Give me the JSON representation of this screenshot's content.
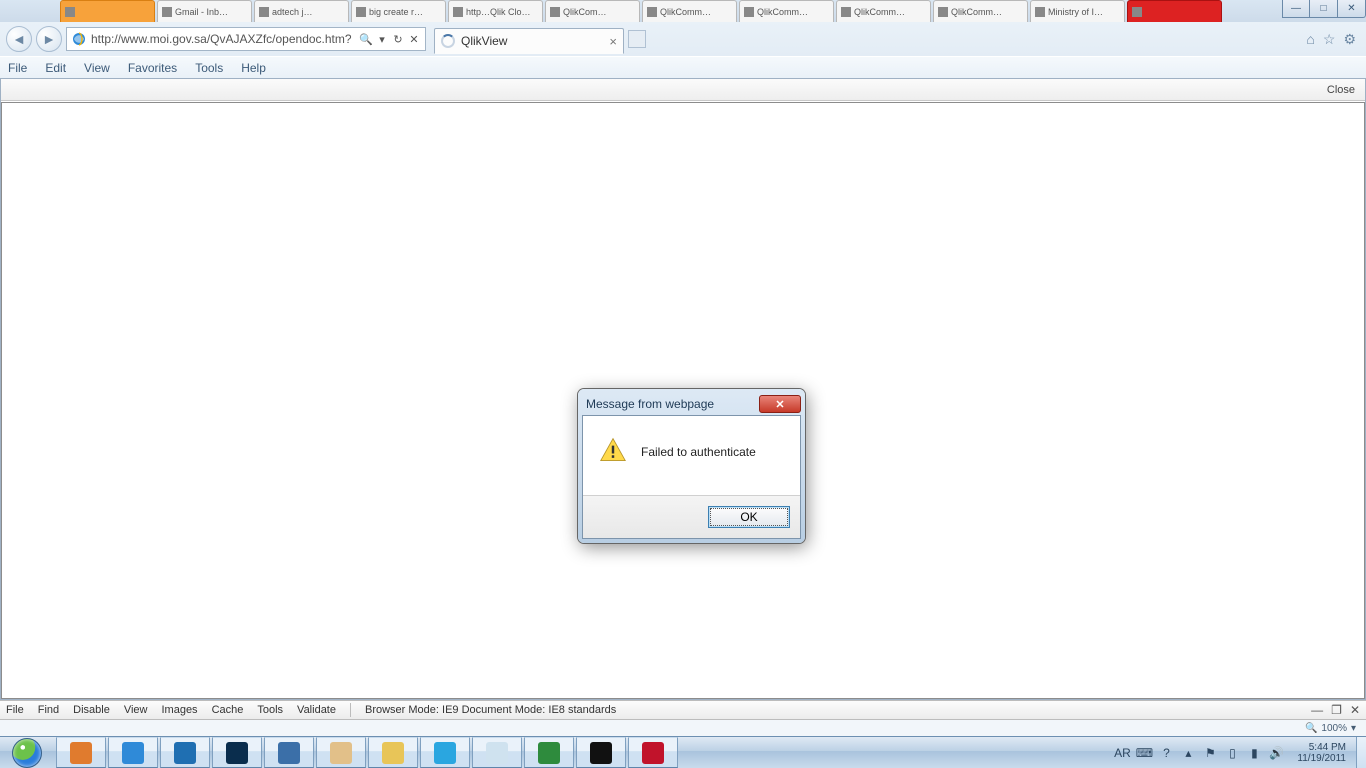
{
  "desktop_tabs": [
    {
      "label": "",
      "cls": "orange"
    },
    {
      "label": "Gmail - Inb…"
    },
    {
      "label": "adtech j…"
    },
    {
      "label": "big create r…"
    },
    {
      "label": "http…Qlik Clo…"
    },
    {
      "label": "QlikCom…"
    },
    {
      "label": "QlikComm…"
    },
    {
      "label": "QlikComm…"
    },
    {
      "label": "QlikComm…"
    },
    {
      "label": "QlikComm…"
    },
    {
      "label": "Ministry of I…"
    },
    {
      "label": "",
      "cls": "red"
    }
  ],
  "window_controls": {
    "min": "—",
    "max": "□",
    "close": "✕"
  },
  "browser": {
    "back": "◄",
    "forward": "►",
    "url": "http://www.moi.gov.sa/QvAJAXZfc/opendoc.htm?",
    "url_bold_part": "moi.gov.sa",
    "search_glyph": "🔍",
    "dropdown_glyph": "▾",
    "refresh_glyph": "↻",
    "stop_glyph": "✕",
    "tab_title": "QlikView",
    "right_icons": {
      "home": "⌂",
      "star": "☆",
      "gear": "⚙"
    }
  },
  "menubar": [
    "File",
    "Edit",
    "View",
    "Favorites",
    "Tools",
    "Help"
  ],
  "page": {
    "close_label": "Close"
  },
  "dialog": {
    "title": "Message from webpage",
    "message": "Failed to authenticate",
    "ok": "OK",
    "close_glyph": "✕"
  },
  "devtools": {
    "items": [
      "File",
      "Find",
      "Disable",
      "View",
      "Images",
      "Cache",
      "Tools",
      "Validate"
    ],
    "mode": "Browser Mode:  IE9   Document Mode:  IE8 standards",
    "right": {
      "min": "—",
      "pop": "❐",
      "close": "✕"
    }
  },
  "status": {
    "zoom": "100%",
    "zoom_glyph": "🔍",
    "dd": "▾"
  },
  "taskbar": {
    "apps": [
      {
        "name": "firefox",
        "color": "#e07b2e"
      },
      {
        "name": "ie",
        "color": "#2f8ad8"
      },
      {
        "name": "check",
        "color": "#1f6fb2"
      },
      {
        "name": "photoshop",
        "color": "#0a2d4d"
      },
      {
        "name": "device",
        "color": "#3b6fa8"
      },
      {
        "name": "paint",
        "color": "#e2c089"
      },
      {
        "name": "explorer",
        "color": "#e8c558"
      },
      {
        "name": "skype",
        "color": "#2aa6e0"
      },
      {
        "name": "notepad",
        "color": "#cfe2ef"
      },
      {
        "name": "excel",
        "color": "#2e8b3d"
      },
      {
        "name": "cmd",
        "color": "#111"
      },
      {
        "name": "acrobat",
        "color": "#c1132b"
      }
    ],
    "lang": "AR",
    "time": "5:44 PM",
    "date": "11/19/2011"
  }
}
